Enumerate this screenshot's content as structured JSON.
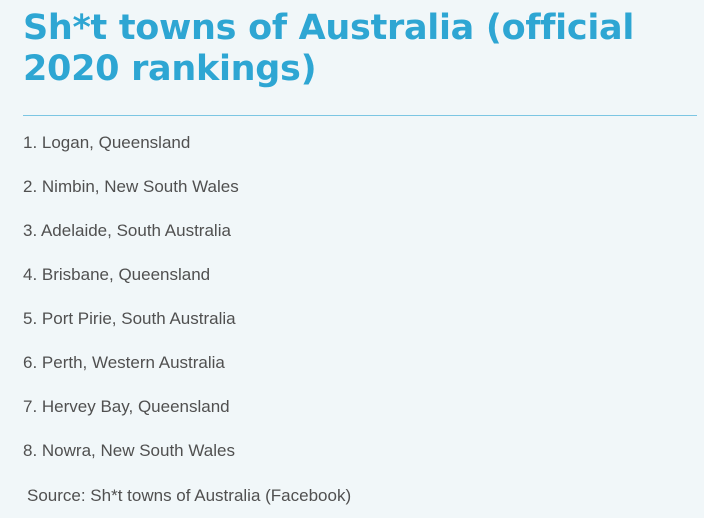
{
  "title": "Sh*t towns of Australia (official 2020 rankings)",
  "rankings": [
    "1. Logan, Queensland",
    "2. Nimbin, New South Wales",
    "3. Adelaide, South Australia",
    "4. Brisbane, Queensland",
    "5. Port Pirie, South Australia",
    "6. Perth, Western Australia",
    "7. Hervey Bay, Queensland",
    "8. Nowra, New South Wales"
  ],
  "source": "Source: Sh*t towns of Australia (Facebook)",
  "colors": {
    "title": "#2ea6d3",
    "rule": "#7cc6e3",
    "background": "#f1f7f9",
    "text": "#505050"
  }
}
